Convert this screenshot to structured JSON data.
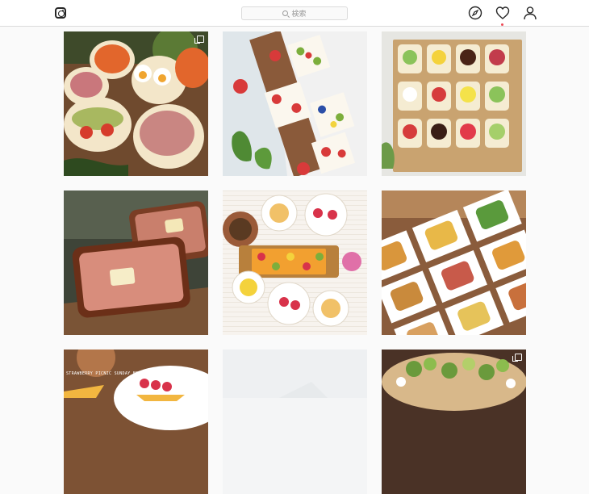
{
  "header": {
    "logo_icon": "instagram-camera-icon",
    "search_placeholder": "検索",
    "nav_icons": [
      "explore-compass-icon",
      "activity-heart-icon",
      "profile-user-icon"
    ],
    "notification_color": "#ed4956"
  },
  "feed": {
    "posts": [
      {
        "subject": "open-face toast with ham, avocado and egg",
        "multi_photo": true
      },
      {
        "subject": "strawberry and kiwi sandwiches on cloth",
        "multi_photo": false
      },
      {
        "subject": "rows of fruit toast squares",
        "multi_photo": false
      },
      {
        "subject": "bacon toast with butter pat",
        "multi_photo": false
      },
      {
        "subject": "fruit tart with tea cups and cakes",
        "multi_photo": false
      },
      {
        "subject": "assorted toasts on white plates",
        "multi_photo": false
      },
      {
        "subject": "breakfast plate with strawberries",
        "multi_photo": false,
        "caption": "STRAWBERRY PICNIC SUNDAY BRUNCH"
      },
      {
        "subject": "white flatlay",
        "multi_photo": false
      },
      {
        "subject": "green salad on toast",
        "multi_photo": true
      }
    ]
  }
}
